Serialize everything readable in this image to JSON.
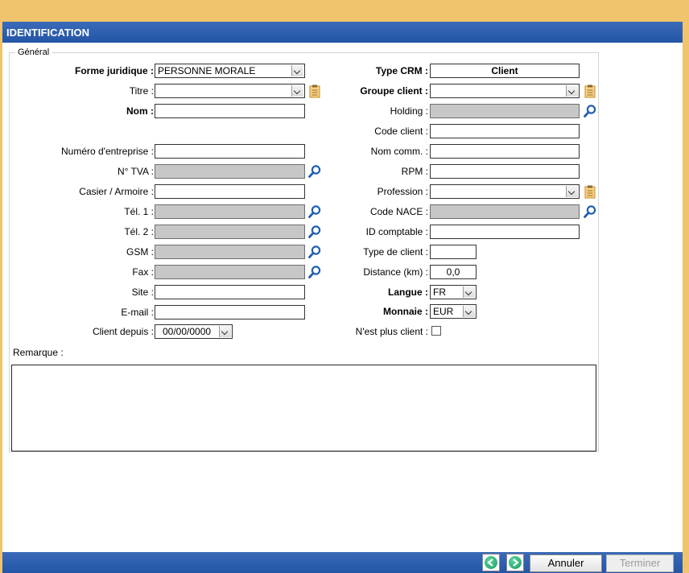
{
  "window": {
    "title": "IDENTIFICATION"
  },
  "group": {
    "legend": "Général"
  },
  "left": {
    "forme_juridique": {
      "label": "Forme juridique :",
      "value": "PERSONNE MORALE"
    },
    "titre": {
      "label": "Titre :",
      "value": ""
    },
    "nom": {
      "label": "Nom :",
      "value": ""
    },
    "numero_entreprise": {
      "label": "Numéro d'entreprise :",
      "value": ""
    },
    "tva": {
      "label": "N° TVA :",
      "value": ""
    },
    "casier": {
      "label": "Casier / Armoire :",
      "value": ""
    },
    "tel1": {
      "label": "Tél. 1 :",
      "value": ""
    },
    "tel2": {
      "label": "Tél. 2 :",
      "value": ""
    },
    "gsm": {
      "label": "GSM :",
      "value": ""
    },
    "fax": {
      "label": "Fax :",
      "value": ""
    },
    "site": {
      "label": "Site :",
      "value": ""
    },
    "email": {
      "label": "E-mail :",
      "value": ""
    },
    "client_depuis": {
      "label": "Client depuis :",
      "value": "00/00/0000"
    }
  },
  "right": {
    "type_crm": {
      "label": "Type CRM :",
      "value": "Client"
    },
    "groupe_client": {
      "label": "Groupe client :",
      "value": ""
    },
    "holding": {
      "label": "Holding :",
      "value": ""
    },
    "code_client": {
      "label": "Code client :",
      "value": ""
    },
    "nom_comm": {
      "label": "Nom comm. :",
      "value": ""
    },
    "rpm": {
      "label": "RPM :",
      "value": ""
    },
    "profession": {
      "label": "Profession :",
      "value": ""
    },
    "code_nace": {
      "label": "Code NACE :",
      "value": ""
    },
    "id_comptable": {
      "label": "ID comptable :",
      "value": ""
    },
    "type_client": {
      "label": "Type de client :",
      "value": ""
    },
    "distance": {
      "label": "Distance (km) :",
      "value": "0,0"
    },
    "langue": {
      "label": "Langue :",
      "value": "FR"
    },
    "monnaie": {
      "label": "Monnaie :",
      "value": "EUR"
    },
    "plus_client": {
      "label": "N'est plus client :",
      "checked": false
    }
  },
  "remarque": {
    "label": "Remarque :",
    "value": ""
  },
  "footer": {
    "prev_icon": "arrow-left-circle-icon",
    "next_icon": "arrow-right-circle-icon",
    "cancel_label": "Annuler",
    "finish_label": "Terminer"
  },
  "colors": {
    "titlebar": "#2a5aab",
    "background": "#f0c46c",
    "disabled_field": "#c7c7c7",
    "search_icon": "#1f5fb0",
    "clipboard_icon": "#e8a93c"
  }
}
